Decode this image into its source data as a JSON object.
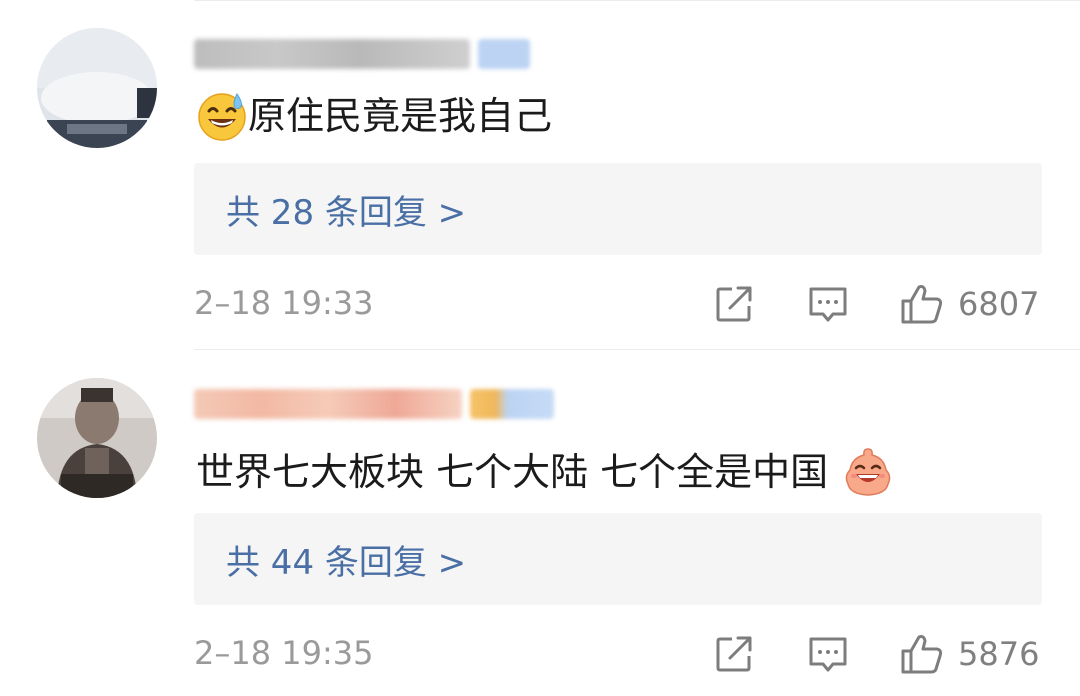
{
  "comments": [
    {
      "comment_text": "原住民竟是我自己",
      "emoji_icon": "grinning-sweat-emoji",
      "reply_label": "共 28 条回复 >",
      "timestamp": "2–18 19:33",
      "likes": "6807"
    },
    {
      "comment_text": "世界七大板块 七个大陆 七个全是中国",
      "emoji_icon": "laughing-blob-emoji",
      "reply_label": "共 44 条回复 >",
      "timestamp": "2–18 19:35",
      "likes": "5876"
    }
  ],
  "colors": {
    "reply_link": "#4a6fa5",
    "reply_background": "#f5f5f5",
    "meta_text": "#9a9a9a",
    "icon_stroke": "#7d7d7d"
  }
}
